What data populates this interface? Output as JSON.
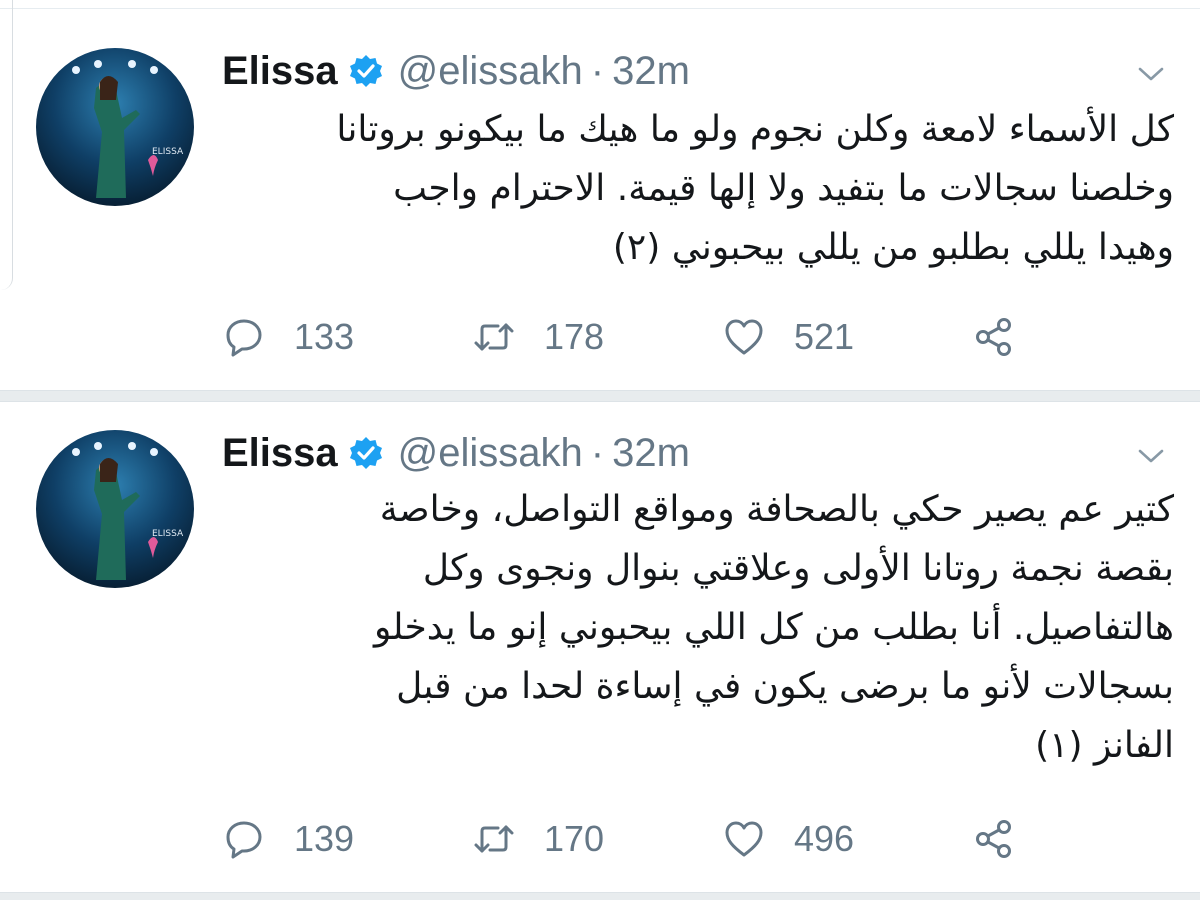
{
  "tweets": [
    {
      "author": {
        "name": "Elissa",
        "handle": "@elissakh",
        "verified": true,
        "avatar_caption": "ELISSA"
      },
      "separator": "·",
      "time": "32m",
      "text_lines": [
        "كل الأسماء لامعة وكلن نجوم ولو ما هيك ما بيكونو بروتانا",
        "وخلصنا سجالات ما بتفيد ولا إلها قيمة. الاحترام واجب",
        "وهيدا يللي بطلبو من يللي بيحبوني (٢)"
      ],
      "actions": {
        "replies": "133",
        "retweets": "178",
        "likes": "521"
      }
    },
    {
      "author": {
        "name": "Elissa",
        "handle": "@elissakh",
        "verified": true,
        "avatar_caption": "ELISSA"
      },
      "separator": "·",
      "time": "32m",
      "text_lines": [
        "كتير عم يصير حكي بالصحافة ومواقع التواصل، وخاصة",
        "بقصة نجمة روتانا الأولى وعلاقتي بنوال ونجوى وكل",
        "هالتفاصيل. أنا بطلب من كل اللي بيحبوني إنو ما يدخلو",
        "بسجالات لأنو ما برضى يكون في إساءة لحدا من قبل",
        "الفانز (١)"
      ],
      "actions": {
        "replies": "139",
        "retweets": "170",
        "likes": "496"
      }
    }
  ],
  "icons": {
    "reply": "speech-bubble-icon",
    "retweet": "retweet-icon",
    "like": "heart-icon",
    "share": "share-icon",
    "menu": "chevron-down-icon",
    "verified": "verified-badge-icon"
  },
  "colors": {
    "text": "#14171a",
    "muted": "#657786",
    "verified": "#1da1f2",
    "separator": "#e8ecee"
  }
}
